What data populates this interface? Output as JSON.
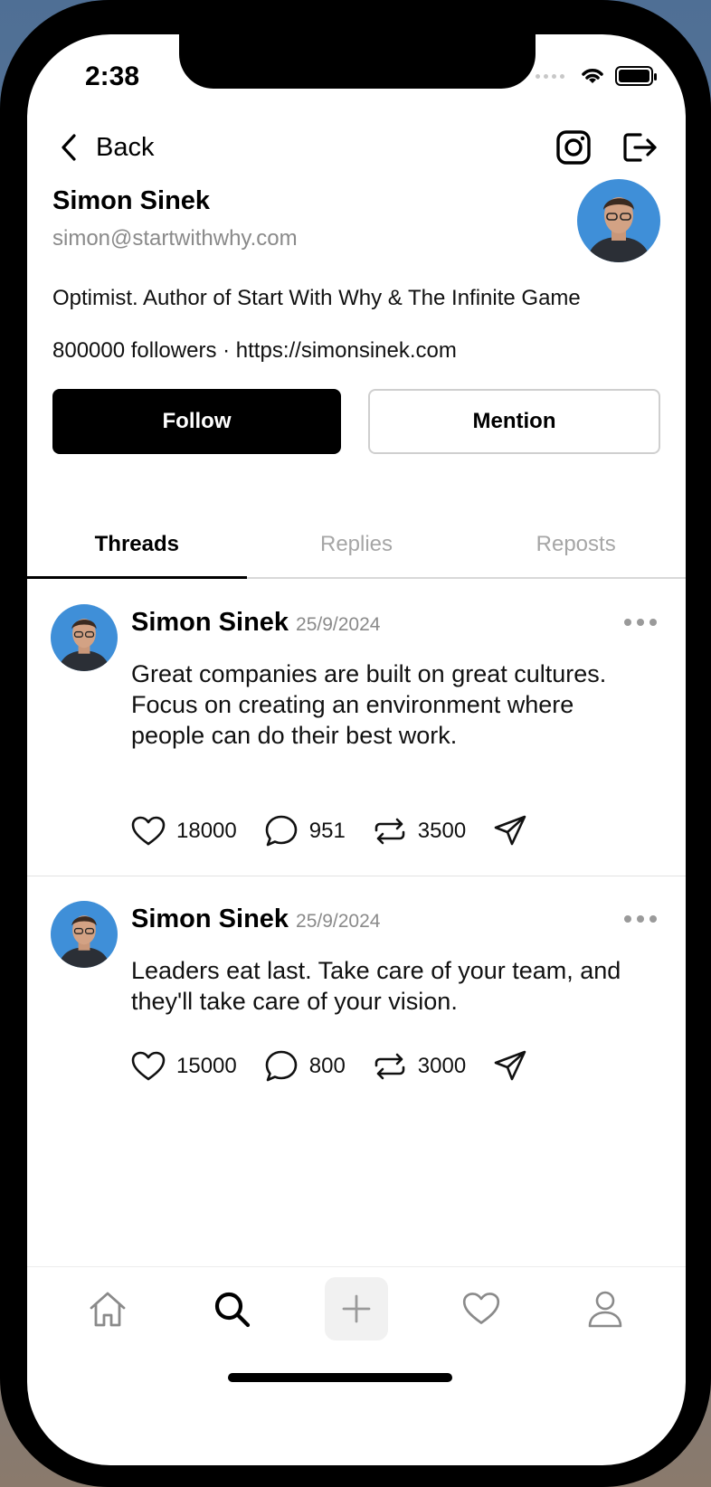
{
  "status_bar": {
    "time": "2:38"
  },
  "topbar": {
    "back_label": "Back"
  },
  "profile": {
    "name": "Simon Sinek",
    "email": "simon@startwithwhy.com",
    "bio": "Optimist. Author of Start With Why & The Infinite Game",
    "meta": "800000 followers · https://simonsinek.com",
    "follow_label": "Follow",
    "mention_label": "Mention"
  },
  "tabs": [
    {
      "label": "Threads"
    },
    {
      "label": "Replies"
    },
    {
      "label": "Reposts"
    }
  ],
  "posts": [
    {
      "author": "Simon Sinek",
      "date": "25/9/2024",
      "text": "Great companies are built on great cultures. Focus on creating an environment where people can do their best work.",
      "likes": "18000",
      "comments": "951",
      "reposts": "3500"
    },
    {
      "author": "Simon Sinek",
      "date": "25/9/2024",
      "text": "Leaders eat last. Take care of your team, and they'll take care of your vision.",
      "likes": "15000",
      "comments": "800",
      "reposts": "3000"
    }
  ],
  "icons": {
    "back": "chevron-left-icon",
    "instagram": "instagram-icon",
    "logout": "logout-icon",
    "like": "heart-icon",
    "comment": "comment-icon",
    "repost": "repost-icon",
    "share": "send-icon",
    "nav": [
      "home-icon",
      "search-icon",
      "plus-icon",
      "heart-icon",
      "profile-icon"
    ]
  },
  "colors": {
    "primary": "#000000",
    "muted": "#8a8a8a",
    "border": "#cfcfcf"
  }
}
